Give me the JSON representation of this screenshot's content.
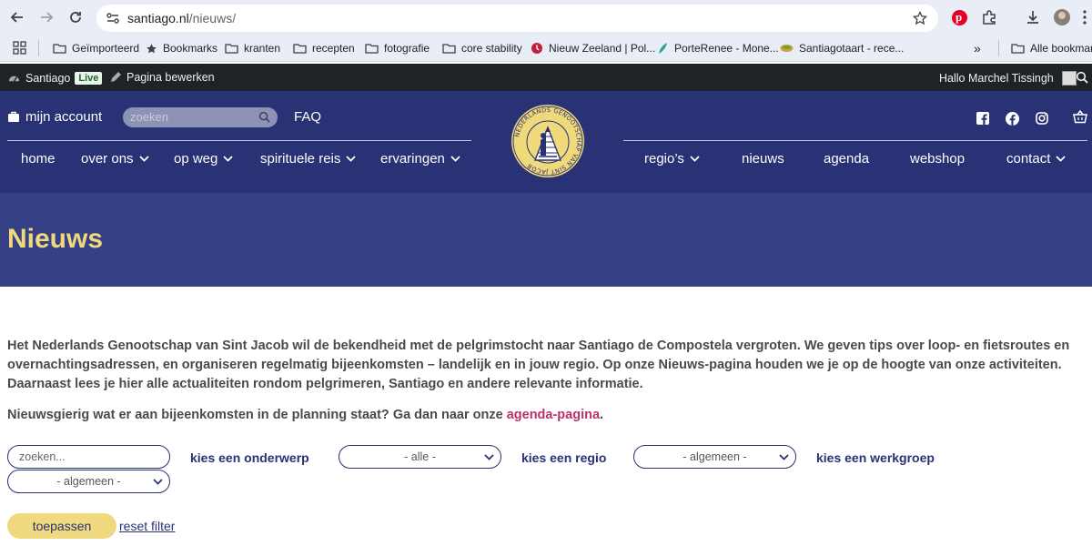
{
  "browser": {
    "url_host": "santiago.nl",
    "url_path": "/nieuws/",
    "bookmarks": [
      {
        "label": "Geïmporteerd",
        "icon": "folder-icon"
      },
      {
        "label": "Bookmarks",
        "icon": "star-icon"
      },
      {
        "label": "kranten",
        "icon": "folder-icon"
      },
      {
        "label": "recepten",
        "icon": "folder-icon"
      },
      {
        "label": "fotografie",
        "icon": "folder-icon"
      },
      {
        "label": "core stability",
        "icon": "folder-icon"
      },
      {
        "label": "Nieuw Zeeland | Pol...",
        "icon": "site-icon"
      },
      {
        "label": "PorteRenee - Mone...",
        "icon": "site-icon"
      },
      {
        "label": "Santiagotaart - rece...",
        "icon": "site-icon"
      }
    ],
    "all_bookmarks": "Alle bookmarks",
    "overflow": "»"
  },
  "adminbar": {
    "site": "Santiago",
    "live": "Live",
    "edit": "Pagina bewerken",
    "greeting": "Hallo Marchel Tissingh"
  },
  "header": {
    "account": "mijn account",
    "search_placeholder": "zoeken",
    "faq": "FAQ",
    "nav_left": [
      {
        "label": "home",
        "dropdown": false
      },
      {
        "label": "over ons",
        "dropdown": true
      },
      {
        "label": "op weg",
        "dropdown": true
      },
      {
        "label": "spirituele reis",
        "dropdown": true
      },
      {
        "label": "ervaringen",
        "dropdown": true
      }
    ],
    "nav_right": [
      {
        "label": "regio’s",
        "dropdown": true
      },
      {
        "label": "nieuws",
        "dropdown": false
      },
      {
        "label": "agenda",
        "dropdown": false
      },
      {
        "label": "webshop",
        "dropdown": false
      },
      {
        "label": "contact",
        "dropdown": true
      }
    ],
    "logo_text": "NEDERLANDS GENOOTSCHAP VAN SINT JACOB"
  },
  "page": {
    "title": "Nieuws",
    "intro_lines": [
      "Het Nederlands Genootschap van Sint Jacob wil de bekendheid met de pelgrimstocht naar Santiago de Compostela vergroten. We geven tips over loop- en fietsroutes en",
      "overnachtingsadressen, en organiseren regelmatig bijeenkomsten – landelijk en in jouw regio. Op onze Nieuws-pagina houden we je op de hoogte van onze activiteiten.",
      "Daarnaast lees je hier alle actualiteiten rondom pelgrimeren, Santiago en andere relevante informatie."
    ],
    "intro2": "Nieuwsgierig wat er aan bijeenkomsten in de planning staat? Ga dan naar onze ",
    "intro2_link": "agenda-pagina",
    "intro2_end": "."
  },
  "filters": {
    "search_placeholder": "zoeken...",
    "topic_label": "kies een onderwerp",
    "topic_value": "- alle -",
    "region_label": "kies een regio",
    "region_value": "- algemeen -",
    "group_label": "kies een werkgroep",
    "group_value": "- algemeen -",
    "apply": "toepassen",
    "reset": "reset filter"
  },
  "colors": {
    "header_bg": "#283274",
    "hero_bg": "#364087",
    "title_yellow": "#f0d97a",
    "link_pink": "#b8336a",
    "button_yellow": "#f1d97f"
  }
}
